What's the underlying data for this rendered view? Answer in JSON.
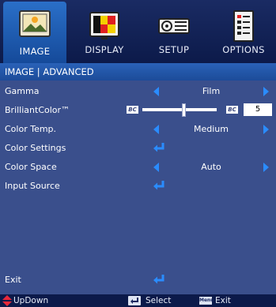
{
  "tabs": [
    {
      "label": "IMAGE",
      "icon": "image-icon",
      "active": true
    },
    {
      "label": "DISPLAY",
      "icon": "display-icon",
      "active": false
    },
    {
      "label": "SETUP",
      "icon": "setup-icon",
      "active": false
    },
    {
      "label": "OPTIONS",
      "icon": "options-icon",
      "active": false
    }
  ],
  "breadcrumb": "IMAGE | ADVANCED",
  "menu": {
    "gamma": {
      "label": "Gamma",
      "value": "Film"
    },
    "brilliant_color": {
      "label": "BrilliantColor™",
      "value": "5",
      "logo_text": "BC",
      "level_fraction": 0.55
    },
    "color_temp": {
      "label": "Color Temp.",
      "value": "Medium"
    },
    "color_settings": {
      "label": "Color Settings"
    },
    "color_space": {
      "label": "Color Space",
      "value": "Auto"
    },
    "input_source": {
      "label": "Input Source"
    },
    "exit": {
      "label": "Exit"
    }
  },
  "footer": {
    "updown": "UpDown",
    "select": "Select",
    "menu_key": "Menu",
    "exit": "Exit"
  },
  "colors": {
    "background": "#3a4f8c",
    "accent_arrow": "#2a8cff",
    "tab_active": "#2a6fc8",
    "footer_bg": "#0c1a4a"
  }
}
